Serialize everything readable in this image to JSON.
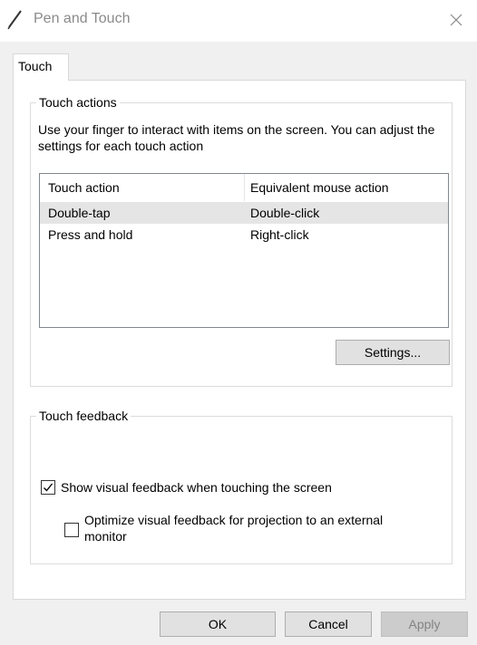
{
  "window": {
    "title": "Pen and Touch",
    "icon": "pen-icon",
    "close_icon": "close-icon"
  },
  "tabs": [
    {
      "label": "Touch",
      "selected": true
    }
  ],
  "touch_actions": {
    "legend": "Touch actions",
    "description": "Use your finger to interact with items on the screen. You can adjust the settings for each touch action",
    "columns": [
      "Touch action",
      "Equivalent mouse action"
    ],
    "rows": [
      {
        "action": "Double-tap",
        "mouse": "Double-click"
      },
      {
        "action": "Press and hold",
        "mouse": "Right-click"
      }
    ],
    "settings_button": "Settings..."
  },
  "touch_feedback": {
    "legend": "Touch feedback",
    "show_visual_feedback": {
      "label": "Show visual feedback when touching the screen",
      "checked": true
    },
    "optimize_projection": {
      "label_line1": "Optimize visual feedback for projection to an external",
      "label_line2": "monitor",
      "checked": false
    }
  },
  "buttons": {
    "ok": "OK",
    "cancel": "Cancel",
    "apply": "Apply",
    "apply_enabled": false
  },
  "colors": {
    "dialog_bg": "#f0f0f0",
    "panel_bg": "#ffffff",
    "row_hover": "#e5e5e5",
    "button_bg": "#e1e1e1",
    "disabled_button_bg": "#cccccc"
  }
}
